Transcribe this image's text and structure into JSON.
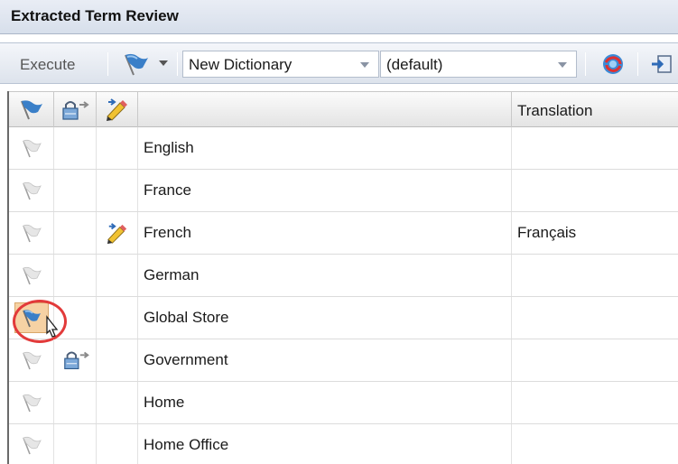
{
  "panel": {
    "title": "Extracted Term Review"
  },
  "toolbar": {
    "execute_label": "Execute",
    "dictionary_value": "New Dictionary",
    "language_value": "(default)"
  },
  "grid": {
    "columns": [
      "",
      "",
      "",
      "",
      "Translation"
    ],
    "rows": [
      {
        "term": "English",
        "translation": "",
        "locked": false,
        "edited": false,
        "flag_active": false
      },
      {
        "term": "France",
        "translation": "",
        "locked": false,
        "edited": false,
        "flag_active": false
      },
      {
        "term": "French",
        "translation": "Français",
        "locked": false,
        "edited": true,
        "flag_active": false
      },
      {
        "term": "German",
        "translation": "",
        "locked": false,
        "edited": false,
        "flag_active": false
      },
      {
        "term": "Global Store",
        "translation": "",
        "locked": false,
        "edited": false,
        "flag_active": true
      },
      {
        "term": "Government",
        "translation": "",
        "locked": true,
        "edited": false,
        "flag_active": false
      },
      {
        "term": "Home",
        "translation": "",
        "locked": false,
        "edited": false,
        "flag_active": false
      },
      {
        "term": "Home Office",
        "translation": "",
        "locked": false,
        "edited": false,
        "flag_active": false
      }
    ]
  },
  "icons": {
    "flag_header": "flag-icon",
    "lock_header": "lock-icon",
    "pencil_header": "pencil-icon",
    "refresh": "refresh-icon",
    "import": "import-icon"
  },
  "colors": {
    "highlight": "#f6d2a4",
    "annotation_circle": "#e23a3a",
    "flag_blue": "#3a7fc8"
  }
}
